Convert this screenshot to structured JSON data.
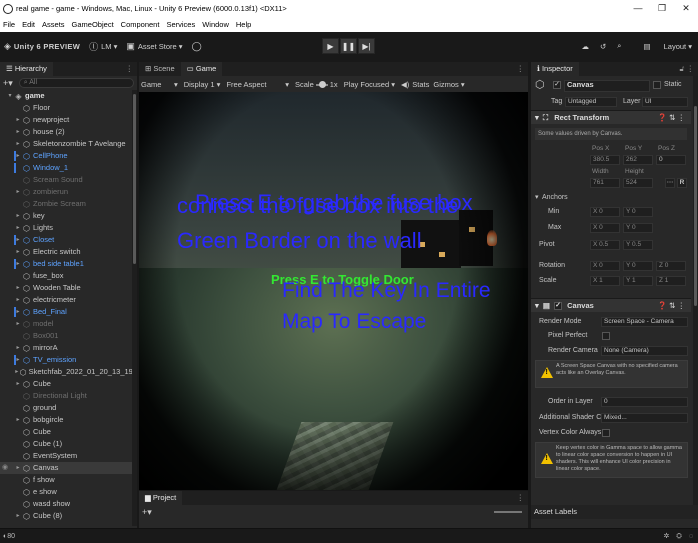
{
  "window": {
    "title": "real game - game - Windows, Mac, Linux - Unity 6 Preview (6000.0.13f1) <DX11>",
    "controls": [
      "—",
      "❐",
      "✕"
    ]
  },
  "menu": [
    "File",
    "Edit",
    "Assets",
    "GameObject",
    "Component",
    "Services",
    "Window",
    "Help"
  ],
  "toolbar": {
    "brand": "Unity 6 PREVIEW",
    "account": "LM",
    "asset_store": "Asset Store",
    "layout": "Layout"
  },
  "hierarchy": {
    "tab": "Hierarchy",
    "search_placeholder": "All",
    "root": "game",
    "items": [
      {
        "name": "Floor",
        "style": "normal",
        "arrow": ""
      },
      {
        "name": "newproject",
        "style": "normal",
        "arrow": "▸"
      },
      {
        "name": "house (2)",
        "style": "normal",
        "arrow": "▸"
      },
      {
        "name": "Skeletonzombie T Avelange",
        "style": "normal",
        "arrow": "▸"
      },
      {
        "name": "CellPhone",
        "style": "blue",
        "arrow": "▸"
      },
      {
        "name": "Window_1",
        "style": "blue",
        "arrow": ""
      },
      {
        "name": "Scream Sound",
        "style": "dim",
        "arrow": ""
      },
      {
        "name": "zombierun",
        "style": "dim",
        "arrow": "▸"
      },
      {
        "name": "Zombie Scream",
        "style": "dim",
        "arrow": ""
      },
      {
        "name": "key",
        "style": "normal",
        "arrow": "▸"
      },
      {
        "name": "Lights",
        "style": "normal",
        "arrow": "▸"
      },
      {
        "name": "Closet",
        "style": "blue",
        "arrow": "▸"
      },
      {
        "name": "Electric switch",
        "style": "normal",
        "arrow": "▸"
      },
      {
        "name": "bed side table1",
        "style": "blue",
        "arrow": "▸"
      },
      {
        "name": "fuse_box",
        "style": "normal",
        "arrow": ""
      },
      {
        "name": "Wooden Table",
        "style": "normal",
        "arrow": "▸"
      },
      {
        "name": "electricmeter",
        "style": "normal",
        "arrow": "▸"
      },
      {
        "name": "Bed_Final",
        "style": "blue",
        "arrow": "▸"
      },
      {
        "name": "model",
        "style": "dim",
        "arrow": "▸"
      },
      {
        "name": "Box001",
        "style": "dim",
        "arrow": ""
      },
      {
        "name": "mirrorA",
        "style": "normal",
        "arrow": "▸"
      },
      {
        "name": "TV_emission",
        "style": "blue",
        "arrow": "▸"
      },
      {
        "name": "Sketchfab_2022_01_20_13_19_",
        "style": "normal",
        "arrow": "▸"
      },
      {
        "name": "Cube",
        "style": "normal",
        "arrow": "▸"
      },
      {
        "name": "Directional Light",
        "style": "dim",
        "arrow": ""
      },
      {
        "name": "ground",
        "style": "normal",
        "arrow": ""
      },
      {
        "name": "bobgircle",
        "style": "normal",
        "arrow": "▸"
      },
      {
        "name": "Cube",
        "style": "normal",
        "arrow": ""
      },
      {
        "name": "Cube (1)",
        "style": "normal",
        "arrow": ""
      },
      {
        "name": "EventSystem",
        "style": "normal",
        "arrow": ""
      },
      {
        "name": "Canvas",
        "style": "selected",
        "arrow": "▸"
      },
      {
        "name": "f show",
        "style": "normal",
        "arrow": ""
      },
      {
        "name": "e show",
        "style": "normal",
        "arrow": ""
      },
      {
        "name": "wasd show",
        "style": "normal",
        "arrow": ""
      },
      {
        "name": "Cube (8)",
        "style": "normal",
        "arrow": "▸"
      }
    ]
  },
  "scene_tabs": [
    "Scene",
    "Game"
  ],
  "game_toolbar": {
    "mode": "Game",
    "display": "Display 1",
    "aspect": "Free Aspect",
    "scale_label": "Scale",
    "scale_value": "1x",
    "play_focused": "Play Focused",
    "stats": "Stats",
    "gizmos": "Gizmos"
  },
  "game_view": {
    "line1_a": "Press E to grab the fuse box",
    "line1_b": "connect the fuse box  into the",
    "line2": "Green Border on the wall",
    "green": "Press E to Toggle Door",
    "line3": "Find The Key In Entire",
    "line4": "Map To Escape"
  },
  "project": {
    "tab": "Project"
  },
  "inspector": {
    "tab": "Inspector",
    "object_name": "Canvas",
    "static_label": "Static",
    "tag_label": "Tag",
    "tag_value": "Untagged",
    "layer_label": "Layer",
    "layer_value": "UI",
    "rect_transform": "Rect Transform",
    "driven_note": "Some values driven by Canvas.",
    "pos_headers": [
      "Pos X",
      "Pos Y",
      "Pos Z"
    ],
    "pos_values": [
      "380.5",
      "262",
      "0"
    ],
    "size_headers": [
      "Width",
      "Height"
    ],
    "size_values": [
      "761",
      "524"
    ],
    "anchors": "Anchors",
    "min": "Min",
    "max": "Max",
    "pivot": "Pivot",
    "rotation": "Rotation",
    "scale": "Scale",
    "anchor_min": [
      "X 0",
      "Y 0"
    ],
    "anchor_max": [
      "X 0",
      "Y 0"
    ],
    "pivot_values": [
      "X 0.5",
      "Y 0.5"
    ],
    "rotation_values": [
      "X 0",
      "Y 0",
      "Z 0"
    ],
    "scale_values": [
      "X 1",
      "Y 1",
      "Z 1"
    ],
    "canvas": "Canvas",
    "render_mode_label": "Render Mode",
    "render_mode_value": "Screen Space - Camera",
    "pixel_perfect": "Pixel Perfect",
    "render_camera_label": "Render Camera",
    "render_camera_value": "None (Camera)",
    "camera_warning": "A Screen Space Canvas with no specified camera acts like an Overlay Canvas.",
    "order_label": "Order in Layer",
    "order_value": "0",
    "shader_label": "Additional Shader Ch",
    "shader_value": "Mixed...",
    "vertex_label": "Vertex Color Always",
    "gamma_warning": "Keep vertex color in Gamma space to allow gamma to linear color space conversion to happen in UI shaders. This will enhance UI color precision in linear color space.",
    "asset_labels": "Asset Labels"
  },
  "status": {
    "count": "80"
  }
}
